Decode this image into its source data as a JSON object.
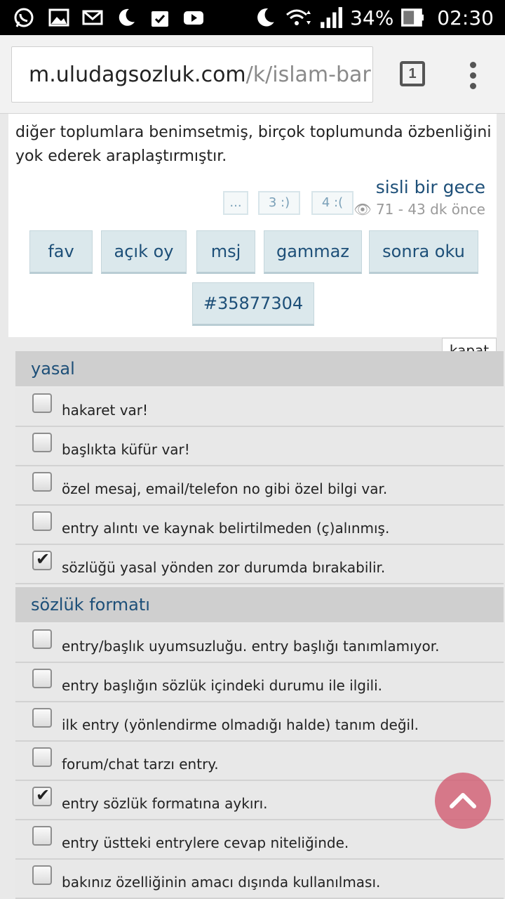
{
  "status_bar": {
    "battery_pct": "34%",
    "clock": "02:30",
    "icons": [
      "whatsapp-icon",
      "gallery-icon",
      "mail-icon",
      "moon-icon",
      "calendar-check-icon",
      "youtube-icon",
      "moon-icon",
      "wifi-icon",
      "signal-icon",
      "battery-icon"
    ]
  },
  "browser": {
    "url_domain": "m.uludagsozluk.com",
    "url_path": "/k/islam-barı",
    "tab_count": "1"
  },
  "entry": {
    "text": "diğer toplumlara benimsetmiş, birçok toplumunda özbenliğini yok ederek araplaştırmıştır.",
    "author": "sisli bir gece",
    "meta": "71 - 43 dk önce",
    "votes": {
      "more": "...",
      "up": "3 :)",
      "down": "4 :("
    },
    "actions": [
      "fav",
      "açık oy",
      "msj",
      "gammaz",
      "sonra oku"
    ],
    "entry_id": "#35877304"
  },
  "report": {
    "close_label": "kapat",
    "sections": [
      {
        "title": "yasal",
        "items": [
          {
            "label": "hakaret var!",
            "checked": false
          },
          {
            "label": "başlıkta küfür var!",
            "checked": false
          },
          {
            "label": "özel mesaj, email/telefon no gibi özel bilgi var.",
            "checked": false
          },
          {
            "label": "entry alıntı ve kaynak belirtilmeden (ç)alınmış.",
            "checked": false
          },
          {
            "label": "sözlüğü yasal yönden zor durumda bırakabilir.",
            "checked": true
          }
        ]
      },
      {
        "title": "sözlük formatı",
        "items": [
          {
            "label": "entry/başlık uyumsuzluğu. entry başlığı tanımlamıyor.",
            "checked": false
          },
          {
            "label": "entry başlığın sözlük içindeki durumu ile ilgili.",
            "checked": false
          },
          {
            "label": "ilk entry (yönlendirme olmadığı halde) tanım değil.",
            "checked": false
          },
          {
            "label": "forum/chat tarzı entry.",
            "checked": false
          },
          {
            "label": "entry sözlük formatına aykırı.",
            "checked": true
          },
          {
            "label": "entry üstteki entrylere cevap niteliğinde.",
            "checked": false
          },
          {
            "label": "bakınız özelliğinin amacı dışında kullanılması.",
            "checked": false
          }
        ]
      }
    ]
  },
  "colors": {
    "accent": "#1d4f78",
    "scroll_top_button": "#d2647a"
  }
}
